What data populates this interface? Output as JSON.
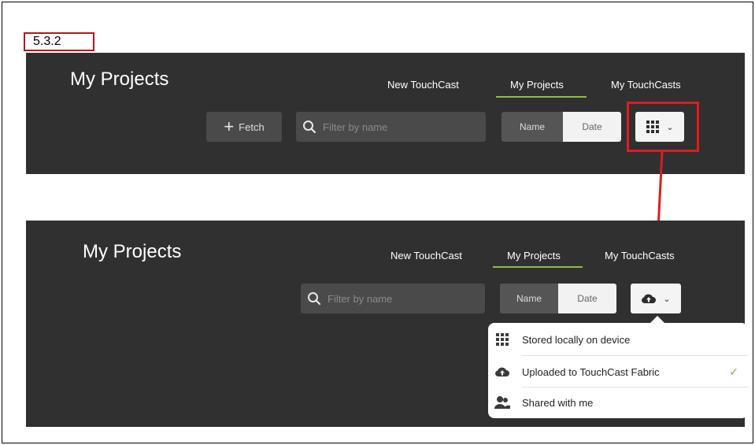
{
  "step_label": "5.3.2",
  "panel_top": {
    "title": "My Projects",
    "tabs": [
      "New TouchCast",
      "My Projects",
      "My TouchCasts"
    ],
    "active_tab": "My Projects",
    "fetch_label": "Fetch",
    "search_placeholder": "Filter by name",
    "sort": {
      "name": "Name",
      "date": "Date",
      "selected": "Date"
    },
    "view_icon": "grid-icon"
  },
  "panel_bottom": {
    "title": "My Projects",
    "tabs": [
      "New TouchCast",
      "My Projects",
      "My TouchCasts"
    ],
    "active_tab": "My Projects",
    "search_placeholder": "Filter by name",
    "sort": {
      "name": "Name",
      "date": "Date",
      "selected": "Date"
    },
    "view_icon": "cloud-upload-icon",
    "menu": [
      {
        "label": "Stored locally on device",
        "icon": "grid-icon",
        "checked": false
      },
      {
        "label": "Uploaded to TouchCast Fabric",
        "icon": "cloud-upload-icon",
        "checked": true
      },
      {
        "label": "Shared with me",
        "icon": "people-icon",
        "checked": false
      }
    ],
    "check_mark": "✓"
  },
  "colors": {
    "panel_bg": "#303030",
    "accent_underline": "#8dbb4a",
    "highlight_red": "#e21b1b",
    "label_border": "#b5171f"
  }
}
